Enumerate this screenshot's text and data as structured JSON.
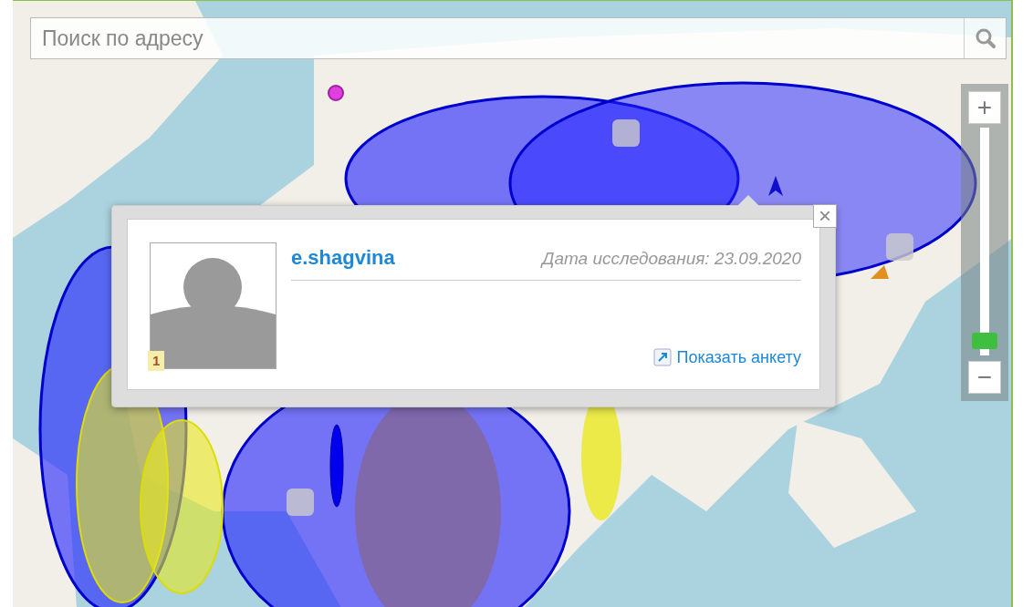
{
  "search": {
    "placeholder": "Поиск по адресу"
  },
  "popup": {
    "username": "e.shagvina",
    "date": "Дата исследования: 23.09.2020",
    "badge": "1",
    "link": "Показать анкету",
    "close": "×"
  },
  "zoom": {
    "plus": "+",
    "minus": "−",
    "level": 0.03
  }
}
